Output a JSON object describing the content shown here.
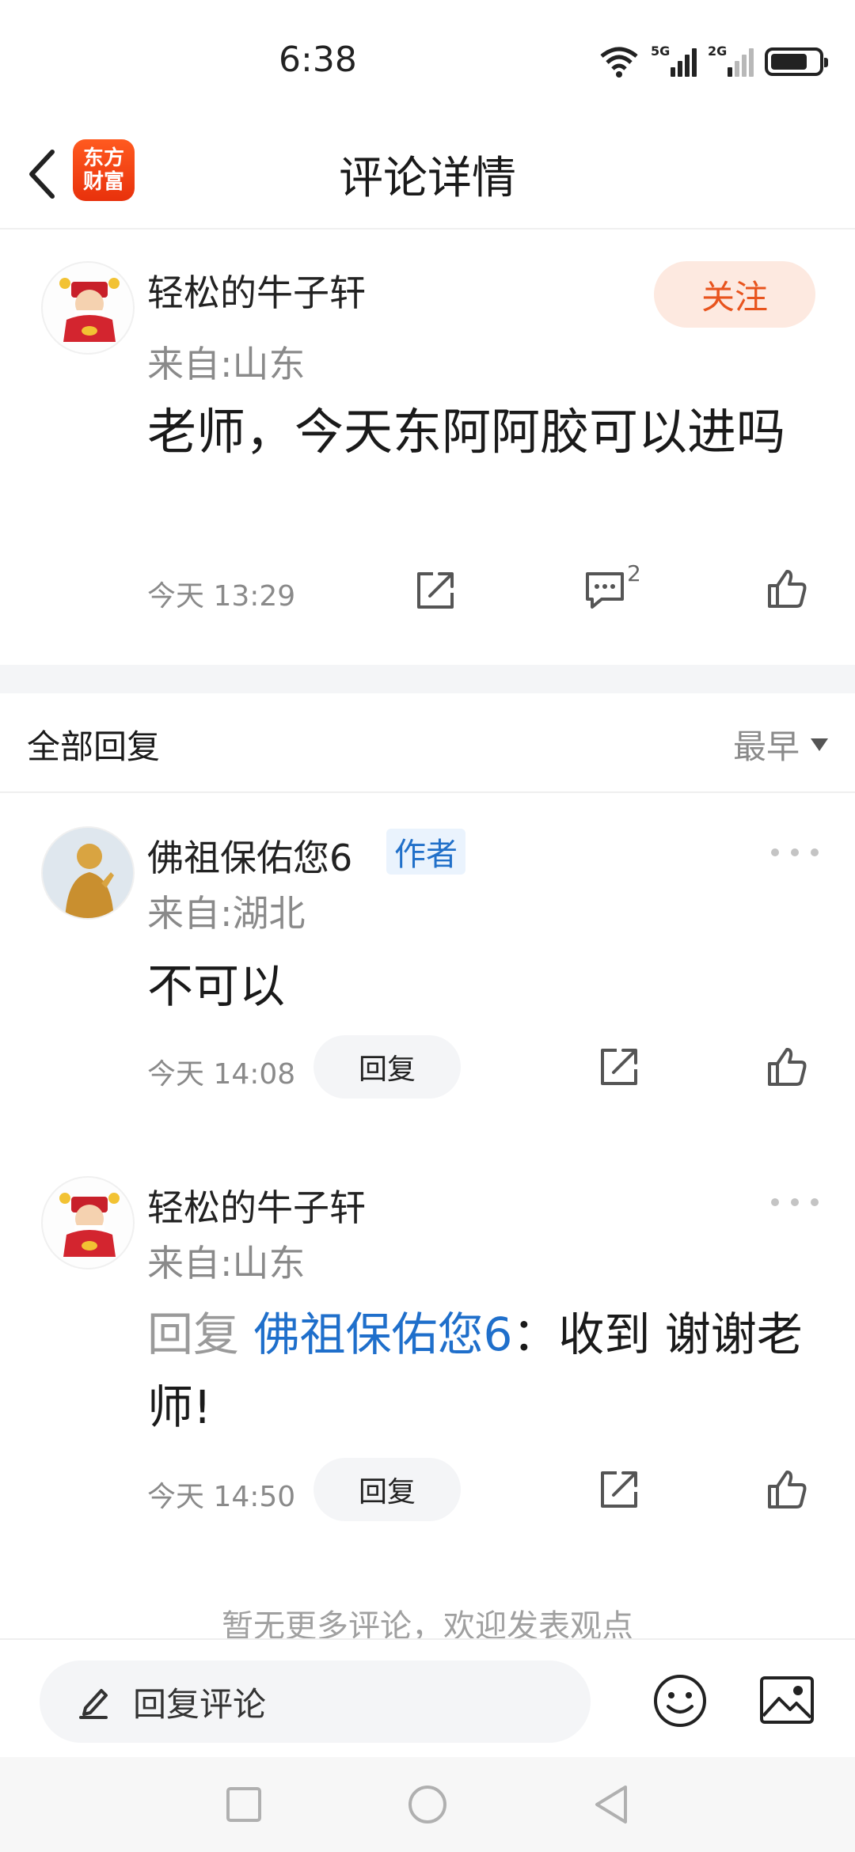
{
  "status_bar": {
    "time": "6:38",
    "sig1_label": "5G",
    "sig2_label": "2G"
  },
  "header": {
    "title": "评论详情",
    "logo_line1": "东方",
    "logo_line2": "财富"
  },
  "main_comment": {
    "username": "轻松的牛子轩",
    "location": "来自:山东",
    "follow_label": "关注",
    "text": "老师，今天东阿阿胶可以进吗",
    "time": "今天 13:29",
    "reply_count": "2"
  },
  "replies_section": {
    "title": "全部回复",
    "sort_label": "最早"
  },
  "replies": [
    {
      "username": "佛祖保佑您6",
      "tag": "作者",
      "location": "来自:湖北",
      "text": "不可以",
      "time": "今天 14:08",
      "reply_label": "回复"
    },
    {
      "username": "轻松的牛子轩",
      "location": "来自:山东",
      "reply_prefix": "回复 ",
      "reply_target": "佛祖保佑您6",
      "text": "：收到  谢谢老师!",
      "time": "今天 14:50",
      "reply_label": "回复"
    }
  ],
  "footer_hint": "暂无更多评论，欢迎发表观点",
  "bottom_bar": {
    "input_placeholder": "回复评论"
  },
  "colors": {
    "accent": "#e8541e",
    "link": "#1f6fcb",
    "author_tag_bg": "#eaf3fd"
  },
  "icons": [
    "back-icon",
    "share-icon",
    "comment-icon",
    "like-icon",
    "more-icon",
    "edit-icon",
    "emoji-icon",
    "image-icon"
  ]
}
